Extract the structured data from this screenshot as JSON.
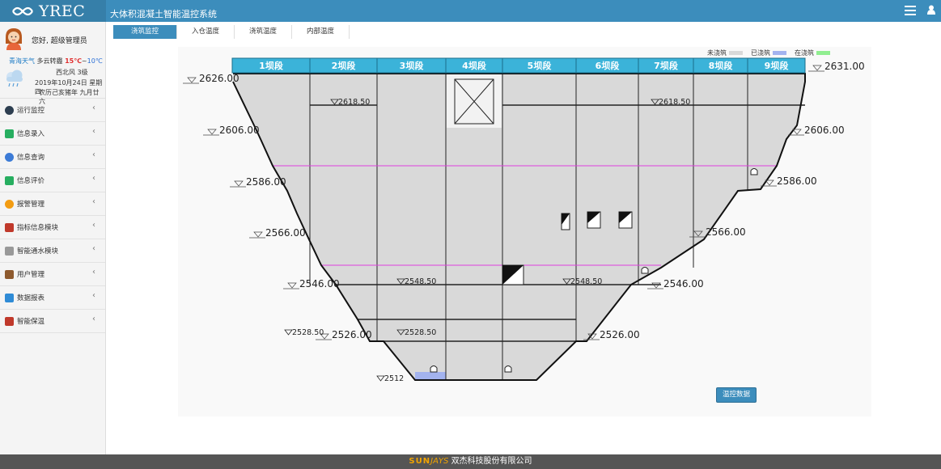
{
  "header": {
    "logo_text": "YREC",
    "app_title": "大体积混凝土智能温控系统"
  },
  "user": {
    "greeting": "您好, 超级管理员"
  },
  "weather": {
    "city": "青海天气",
    "condition": "多云转霾",
    "temp_high": "15℃",
    "separator": "~",
    "temp_low": "10℃",
    "wind": "西北风 3级",
    "date": "2019年10月24日 星期四",
    "lunar": "农历己亥猪年 九月廿六"
  },
  "sidebar": {
    "items": [
      {
        "label": "运行监控",
        "icon": "dashboard-icon"
      },
      {
        "label": "信息录入",
        "icon": "document-icon"
      },
      {
        "label": "信息查询",
        "icon": "search-icon"
      },
      {
        "label": "信息评价",
        "icon": "checkbox-icon"
      },
      {
        "label": "报警管理",
        "icon": "alarm-icon"
      },
      {
        "label": "指标信息模块",
        "icon": "chart-icon"
      },
      {
        "label": "智能通水模块",
        "icon": "water-icon"
      },
      {
        "label": "用户管理",
        "icon": "user-icon"
      },
      {
        "label": "数据报表",
        "icon": "report-icon"
      },
      {
        "label": "智能保温",
        "icon": "tool-icon"
      }
    ],
    "chevron": "‹"
  },
  "tabs": [
    {
      "label": "浇筑监控",
      "active": true
    },
    {
      "label": "入仓温度",
      "active": false
    },
    {
      "label": "浇筑温度",
      "active": false
    },
    {
      "label": "内部温度",
      "active": false
    }
  ],
  "legend": [
    {
      "label": "未浇筑",
      "color": "#d9d9d9"
    },
    {
      "label": "已浇筑",
      "color": "#a3b3ef"
    },
    {
      "label": "在浇筑",
      "color": "#90ee90"
    }
  ],
  "dam": {
    "sections": [
      "1坝段",
      "2坝段",
      "3坝段",
      "4坝段",
      "5坝段",
      "6坝段",
      "7坝段",
      "8坝段",
      "9坝段"
    ],
    "elevations_left": [
      "2626.00",
      "2606.00",
      "2586.00",
      "2566.00",
      "2546.00",
      "2526.00"
    ],
    "elevations_right": [
      "2631.00",
      "2606.00",
      "2586.00",
      "2566.00",
      "2546.00",
      "2526.00"
    ],
    "inner_labels": [
      "2618.50",
      "2618.50",
      "2548.50",
      "2548.50",
      "2528.50",
      "2528.50",
      "2512"
    ],
    "fill_color": "#d9d9d9",
    "poured_color": "#a3b3ef",
    "header_color": "#3bb3d9",
    "magenta_line_color": "#e040e0"
  },
  "actions": {
    "data_button": "温控数据"
  },
  "footer": {
    "brand_sun": "SUN",
    "brand_jays": "JAYS",
    "company": "双杰科技股份有限公司"
  }
}
